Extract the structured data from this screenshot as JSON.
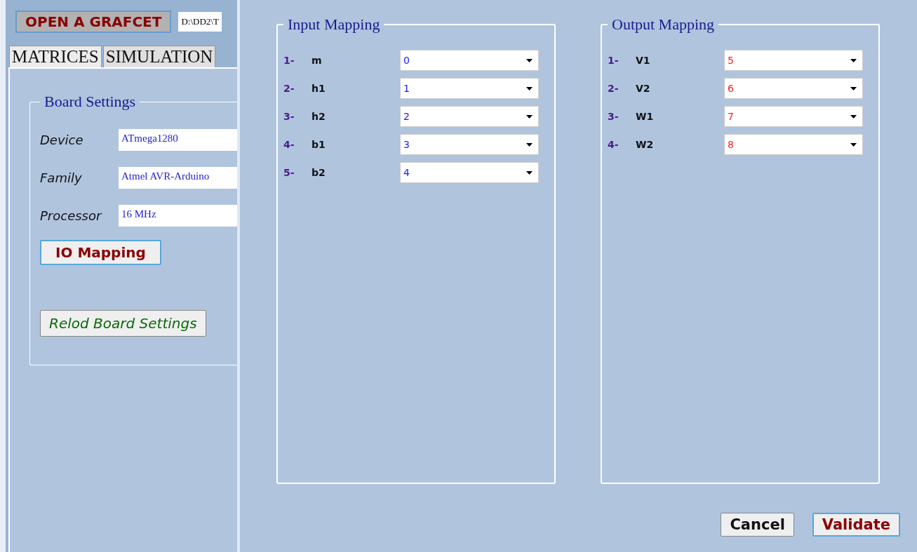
{
  "main_window": {
    "open_button": "OPEN A GRAFCET",
    "file_path": "D:\\DD2\\T",
    "tabs": [
      {
        "label": "MATRICES",
        "selected": true
      },
      {
        "label": "SIMULATION",
        "selected": false
      }
    ],
    "board_settings": {
      "title": "Board Settings",
      "fields": [
        {
          "label": "Device",
          "value": "ATmega1280"
        },
        {
          "label": "Family",
          "value": "Atmel AVR-Arduino"
        },
        {
          "label": "Processor",
          "value": "16 MHz"
        }
      ],
      "io_button": "IO Mapping",
      "reload_button": "Relod Board Settings"
    }
  },
  "dialog": {
    "groups": [
      {
        "title": "Input Mapping",
        "kind": "input",
        "rows": [
          {
            "index": "1-",
            "name": "m",
            "value": "0"
          },
          {
            "index": "2-",
            "name": "h1",
            "value": "1"
          },
          {
            "index": "3-",
            "name": "h2",
            "value": "2"
          },
          {
            "index": "4-",
            "name": "b1",
            "value": "3"
          },
          {
            "index": "5-",
            "name": "b2",
            "value": "4"
          }
        ]
      },
      {
        "title": "Output Mapping",
        "kind": "output",
        "rows": [
          {
            "index": "1-",
            "name": "V1",
            "value": "5"
          },
          {
            "index": "2-",
            "name": "V2",
            "value": "6"
          },
          {
            "index": "3-",
            "name": "W1",
            "value": "7"
          },
          {
            "index": "4-",
            "name": "W2",
            "value": "8"
          }
        ]
      }
    ],
    "cancel_button": "Cancel",
    "validate_button": "Validate"
  }
}
